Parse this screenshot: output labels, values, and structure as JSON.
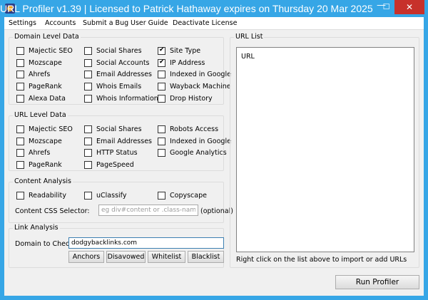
{
  "window": {
    "title": "URL Profiler v1.39 | Licensed to Patrick Hathaway expires on Thursday 20 Mar 2025",
    "min_glyph": "—",
    "max_glyph": "☐",
    "close_glyph": "✕"
  },
  "menu": [
    "Settings",
    "Accounts",
    "Submit a Bug",
    "User Guide",
    "Deactivate License"
  ],
  "domain_level": {
    "title": "Domain Level Data",
    "items": [
      {
        "label": "Majectic SEO",
        "checked": false
      },
      {
        "label": "Social Shares",
        "checked": false
      },
      {
        "label": "Site Type",
        "checked": true
      },
      {
        "label": "Mozscape",
        "checked": false
      },
      {
        "label": "Social Accounts",
        "checked": false
      },
      {
        "label": "IP Address",
        "checked": true
      },
      {
        "label": "Ahrefs",
        "checked": false
      },
      {
        "label": "Email Addresses",
        "checked": false
      },
      {
        "label": "Indexed in Google",
        "checked": false
      },
      {
        "label": "PageRank",
        "checked": false
      },
      {
        "label": "Whois Emails",
        "checked": false
      },
      {
        "label": "Wayback Machine",
        "checked": false
      },
      {
        "label": "Alexa Data",
        "checked": false
      },
      {
        "label": "Whois Information",
        "checked": false
      },
      {
        "label": "Drop History",
        "checked": false
      }
    ]
  },
  "url_level": {
    "title": "URL Level Data",
    "items": [
      {
        "label": "Majectic SEO",
        "checked": false
      },
      {
        "label": "Social Shares",
        "checked": false
      },
      {
        "label": "Robots Access",
        "checked": false
      },
      {
        "label": "Mozscape",
        "checked": false
      },
      {
        "label": "Email Addresses",
        "checked": false
      },
      {
        "label": "Indexed in Google",
        "checked": false
      },
      {
        "label": "Ahrefs",
        "checked": false
      },
      {
        "label": "HTTP Status",
        "checked": false
      },
      {
        "label": "Google Analytics",
        "checked": false
      },
      {
        "label": "PageRank",
        "checked": false
      },
      {
        "label": "PageSpeed",
        "checked": false
      }
    ]
  },
  "content_analysis": {
    "title": "Content Analysis",
    "items": [
      {
        "label": "Readability",
        "checked": false
      },
      {
        "label": "uClassify",
        "checked": false
      },
      {
        "label": "Copyscape",
        "checked": false
      }
    ],
    "css_selector_label": "Content CSS Selector:",
    "css_selector_placeholder": "eg div#content or .class-name",
    "css_selector_value": "",
    "optional_label": "(optional)"
  },
  "link_analysis": {
    "title": "Link Analysis",
    "domain_label": "Domain to Check:",
    "domain_value": "dodgybacklinks.com",
    "buttons": [
      "Anchors",
      "Disavowed",
      "Whitelist",
      "Blacklist"
    ]
  },
  "url_list": {
    "title": "URL List",
    "header": "URL",
    "hint": "Right click on the list above to import or add URLs"
  },
  "run_button": "Run Profiler"
}
